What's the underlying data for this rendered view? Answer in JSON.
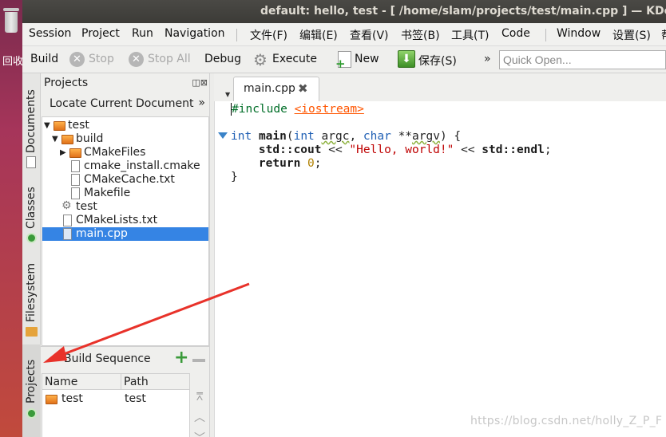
{
  "desktop": {
    "label": "回收站"
  },
  "window": {
    "title": "default:  hello, test - [ /home/slam/projects/test/main.cpp ] — KDevelop"
  },
  "menu": [
    "Session",
    "Project",
    "Run",
    "Navigation",
    "文件(F)",
    "编辑(E)",
    "查看(V)",
    "书签(B)",
    "工具(T)",
    "Code",
    "Window",
    "设置(S)",
    "帮"
  ],
  "toolbar": {
    "build": "Build",
    "stop": "Stop",
    "stop_all": "Stop All",
    "debug": "Debug",
    "execute": "Execute",
    "new": "New",
    "save": "保存(S)",
    "overflow": "»",
    "quick_open_placeholder": "Quick Open..."
  },
  "vtabs": {
    "documents": "Documents",
    "classes": "Classes",
    "filesystem": "Filesystem",
    "projects": "Projects"
  },
  "projects_panel": {
    "title": "Projects",
    "locate": "Locate Current Document",
    "locate_chevron": "»",
    "tree": [
      {
        "label": "test",
        "icon": "folder-icon",
        "depth": 0,
        "expanded": true
      },
      {
        "label": "build",
        "icon": "folder-icon",
        "depth": 1,
        "expanded": true
      },
      {
        "label": "CMakeFiles",
        "icon": "folder-icon",
        "depth": 2,
        "expanded": false
      },
      {
        "label": "cmake_install.cmake",
        "icon": "file-icon",
        "depth": 2
      },
      {
        "label": "CMakeCache.txt",
        "icon": "file-icon",
        "depth": 2
      },
      {
        "label": "Makefile",
        "icon": "file-icon",
        "depth": 2
      },
      {
        "label": "test",
        "icon": "gear-icon",
        "depth": 1
      },
      {
        "label": "CMakeLists.txt",
        "icon": "file-icon",
        "depth": 1
      },
      {
        "label": "main.cpp",
        "icon": "cpp-file-icon",
        "depth": 1,
        "selected": true
      }
    ]
  },
  "build_sequence": {
    "title": "Build Sequence",
    "columns": [
      "Name",
      "Path"
    ],
    "rows": [
      {
        "name": "test",
        "path": "test"
      }
    ]
  },
  "editor": {
    "tab_label": "main.cpp",
    "tab_close": "✖",
    "lines": [
      "#include <iostream>",
      "",
      "int main(int argc, char **argv) {",
      "    std::cout << \"Hello, world!\" << std::endl;",
      "    return 0;",
      "}"
    ]
  },
  "watermark": "https://blog.csdn.net/holly_Z_P_F",
  "colors": {
    "selection": "#3584e4",
    "keyword": "#1f5fb4",
    "string": "#bf0303",
    "annotation_arrow": "#e8322a"
  }
}
